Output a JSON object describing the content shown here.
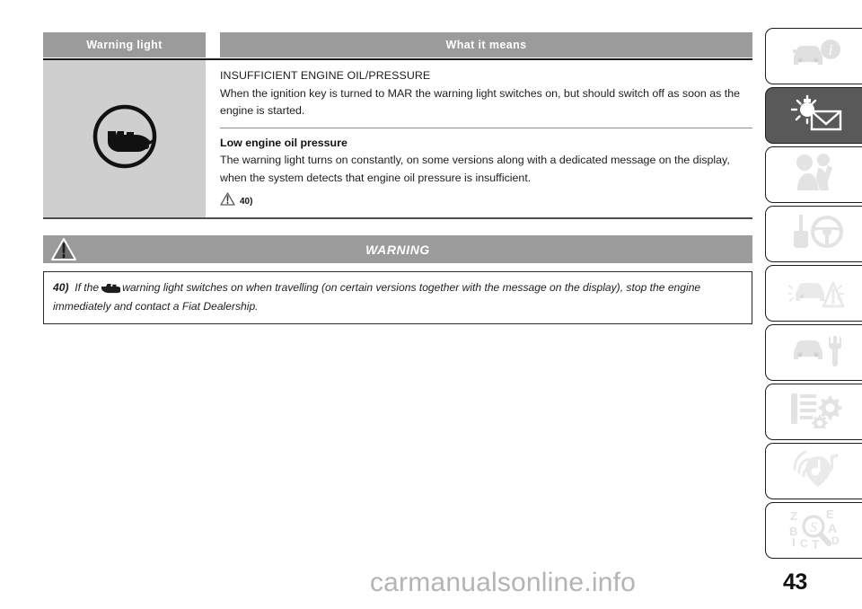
{
  "document": {
    "page_number": "43",
    "watermark": "carmanualsonline.info"
  },
  "table": {
    "headers": {
      "warning_light": "Warning light",
      "what_it_means": "What it means"
    },
    "warning_light_icon": "engine-oil-pressure-warning-icon",
    "blocks": {
      "title": "INSUFFICIENT ENGINE OIL/PRESSURE",
      "intro": "When the ignition key is turned to MAR the warning light switches on, but should switch off as soon as the engine is started.",
      "subhead": "Low engine oil pressure",
      "body": "The warning light turns on constantly, on some versions along with a dedicated message on the display, when the system detects that engine oil pressure is insufficient.",
      "reference": "40)"
    }
  },
  "warning": {
    "banner_title": "WARNING",
    "banner_icon": "warning-triangle-icon",
    "note_number": "40)",
    "note_text_before_icon": "If the",
    "note_text_after_icon": "warning light switches on when travelling (on certain versions together with the message on the display), stop the engine immediately and contact a Fiat Dealership.",
    "inline_icon": "engine-oil-can-icon"
  },
  "sidebar": {
    "tabs": [
      {
        "name": "dashboard-and-controls",
        "icon": "car-info-icon",
        "active": false
      },
      {
        "name": "knowing-your-car",
        "icon": "warning-lights-and-messages-icon",
        "active": true
      },
      {
        "name": "safety",
        "icon": "occupant-safety-icon",
        "active": false
      },
      {
        "name": "starting-and-driving",
        "icon": "key-steering-wheel-icon",
        "active": false
      },
      {
        "name": "in-an-emergency",
        "icon": "car-hazard-triangle-icon",
        "active": false
      },
      {
        "name": "maintenance-and-care",
        "icon": "car-wrench-icon",
        "active": false
      },
      {
        "name": "technical-specifications",
        "icon": "list-gears-icon",
        "active": false
      },
      {
        "name": "multimedia",
        "icon": "audio-navigation-icon",
        "active": false
      },
      {
        "name": "alphabetical-index",
        "icon": "magnifier-letters-icon",
        "active": false
      }
    ]
  },
  "colors": {
    "header_gray": "#9b9b9b",
    "cell_gray": "#cfcfcf",
    "active_tab_gray": "#595959",
    "icon_light_gray": "#e3e3e3",
    "watermark_gray": "#b4b4b4"
  }
}
